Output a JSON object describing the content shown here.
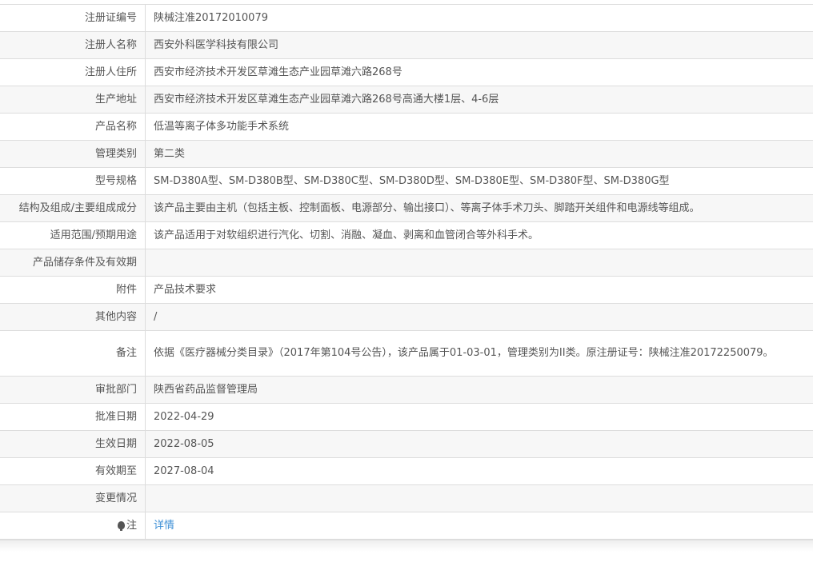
{
  "rows": [
    {
      "label": "注册证编号",
      "value": "陕械注准20172010079"
    },
    {
      "label": "注册人名称",
      "value": "西安外科医学科技有限公司"
    },
    {
      "label": "注册人住所",
      "value": "西安市经济技术开发区草滩生态产业园草滩六路268号"
    },
    {
      "label": "生产地址",
      "value": "西安市经济技术开发区草滩生态产业园草滩六路268号高通大楼1层、4-6层"
    },
    {
      "label": "产品名称",
      "value": "低温等离子体多功能手术系统"
    },
    {
      "label": "管理类别",
      "value": "第二类"
    },
    {
      "label": "型号规格",
      "value": "SM-D380A型、SM-D380B型、SM-D380C型、SM-D380D型、SM-D380E型、SM-D380F型、SM-D380G型"
    },
    {
      "label": "结构及组成/主要组成成分",
      "value": "该产品主要由主机（包括主板、控制面板、电源部分、输出接口）、等离子体手术刀头、脚踏开关组件和电源线等组成。"
    },
    {
      "label": "适用范围/预期用途",
      "value": "该产品适用于对软组织进行汽化、切割、消融、凝血、剥离和血管闭合等外科手术。"
    },
    {
      "label": "产品储存条件及有效期",
      "value": ""
    },
    {
      "label": "附件",
      "value": "产品技术要求"
    },
    {
      "label": "其他内容",
      "value": "/"
    },
    {
      "label": "备注",
      "value": "依据《医疗器械分类目录》（2017年第104号公告），该产品属于01-03-01，管理类别为II类。原注册证号：陕械注准20172250079。"
    },
    {
      "label": "审批部门",
      "value": "陕西省药品监督管理局"
    },
    {
      "label": "批准日期",
      "value": "2022-04-29"
    },
    {
      "label": "生效日期",
      "value": "2022-08-05"
    },
    {
      "label": "有效期至",
      "value": "2027-08-04"
    },
    {
      "label": "变更情况",
      "value": ""
    }
  ],
  "note": {
    "label": "注",
    "link": "详情",
    "icon": "lightbulb-icon"
  }
}
